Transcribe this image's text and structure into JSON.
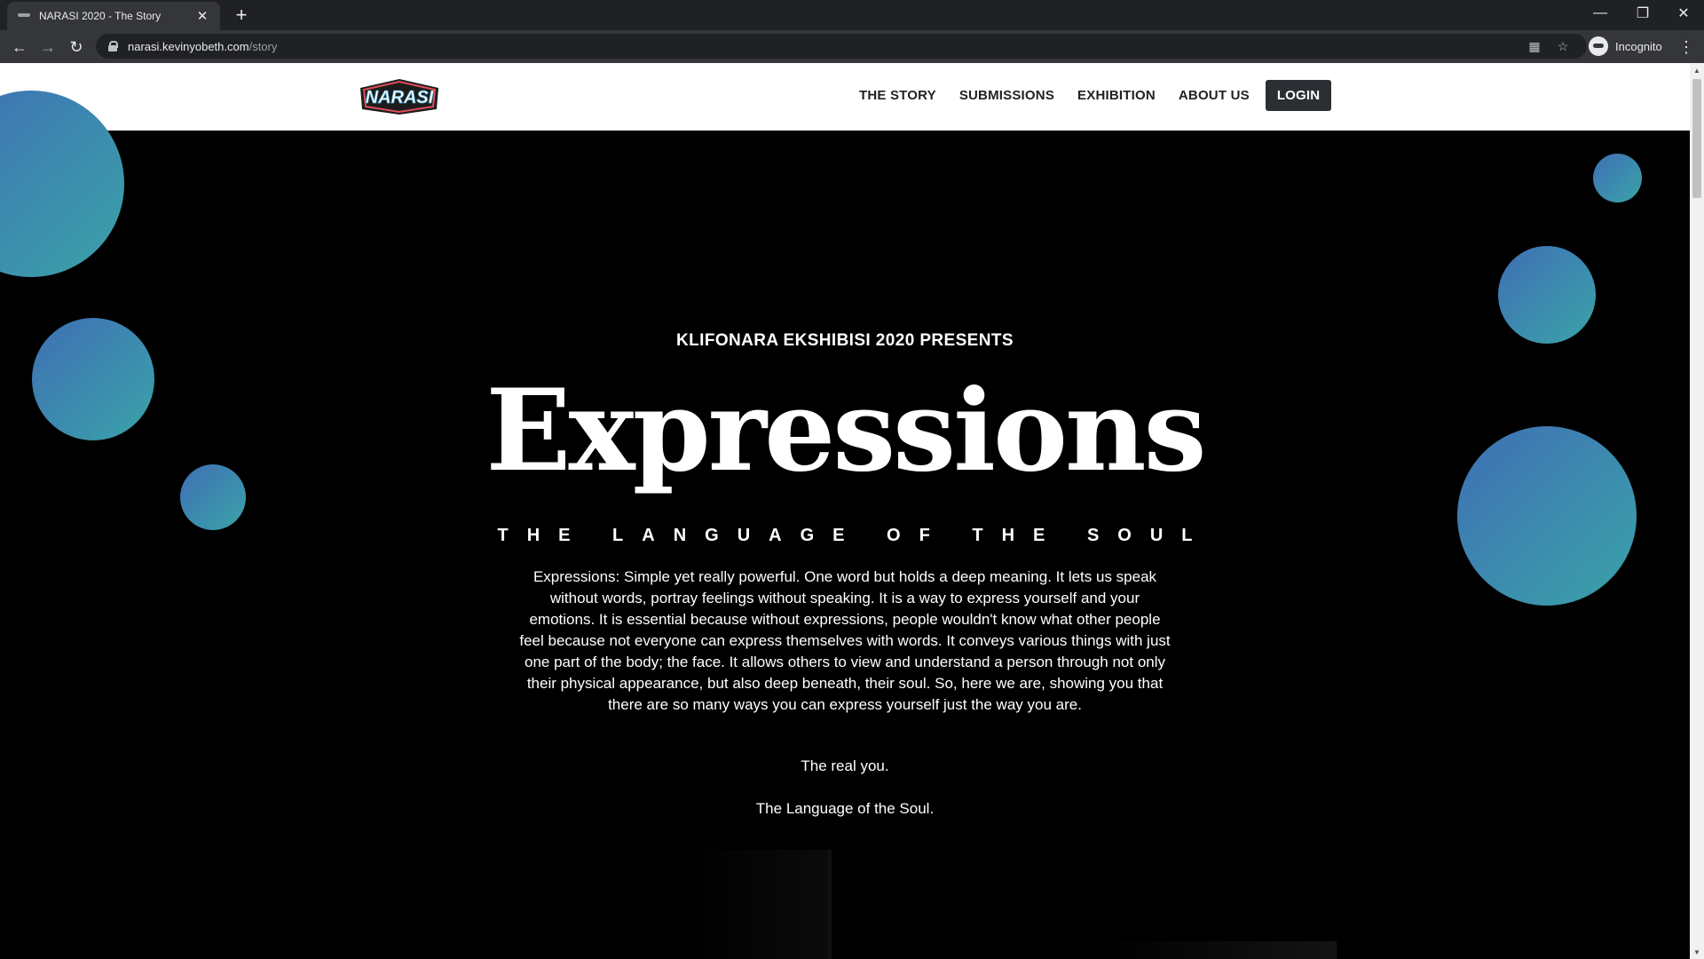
{
  "browser": {
    "tab_title": "NARASI 2020 - The Story",
    "new_tab_glyph": "+",
    "url_host": "narasi.kevinyobeth.com",
    "url_path": "/story",
    "profile_label": "Incognito",
    "icons": [
      "back-icon",
      "forward-icon",
      "reload-icon",
      "lock-icon",
      "translate-icon",
      "star-icon",
      "incognito-icon",
      "menu-icon",
      "minimize-icon",
      "restore-icon",
      "close-icon"
    ]
  },
  "header": {
    "logo_text": "NARASI",
    "nav": [
      {
        "label": "THE STORY"
      },
      {
        "label": "SUBMISSIONS"
      },
      {
        "label": "EXHIBITION"
      },
      {
        "label": "ABOUT US"
      }
    ],
    "login_label": "LOGIN"
  },
  "hero": {
    "presents": "KLIFONARA EKSHIBISI 2020 PRESENTS",
    "title": "Expressions",
    "subtitle": "THE LANGUAGE OF THE SOUL",
    "paragraph": "Expressions: Simple yet really powerful. One word but holds a deep meaning. It lets us speak without words, portray feelings without speaking. It is a way to express yourself and your emotions. It is essential because without expressions, people wouldn't know what other people feel because not everyone can express themselves with words. It conveys various things with just one part of the body; the face. It allows others to view and understand a person through not only their physical appearance, but also deep beneath, their soul. So, here we are, showing you that there are so many ways you can express yourself just the way you are.",
    "line1": "The real you.",
    "line2": "The Language of the Soul."
  },
  "colors": {
    "bubble_start": "#3f6fb5",
    "bubble_end": "#3aa3a8",
    "login_bg": "#2b2f33"
  }
}
